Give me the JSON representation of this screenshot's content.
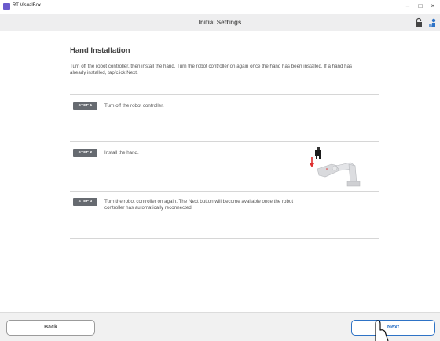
{
  "window": {
    "app_title": "RT VisualBox",
    "minimize": "–",
    "maximize": "□",
    "close": "×"
  },
  "header": {
    "title": "Initial Settings"
  },
  "main": {
    "title": "Hand Installation",
    "description": "Turn off the robot controller, then install the hand. Turn the robot controller on again once the hand has been installed. If a hand has already installed, tap/click Next.",
    "steps": [
      {
        "badge": "STEP 1",
        "text": "Turn off the robot controller."
      },
      {
        "badge": "STEP 2",
        "text": "Install the hand."
      },
      {
        "badge": "STEP 3",
        "text": "Turn the robot controller on again. The Next button will become available once the robot controller has automatically reconnected."
      }
    ]
  },
  "footer": {
    "back_label": "Back",
    "next_label": "Next"
  },
  "colors": {
    "accent": "#2e73c6",
    "badge": "#666a70",
    "header_bg": "#eeeeef",
    "footer_bg": "#f1f1f1"
  },
  "icons": {
    "header_left": "lock-icon",
    "header_right": "person-icon",
    "pointer": "hand-pointer-icon"
  }
}
